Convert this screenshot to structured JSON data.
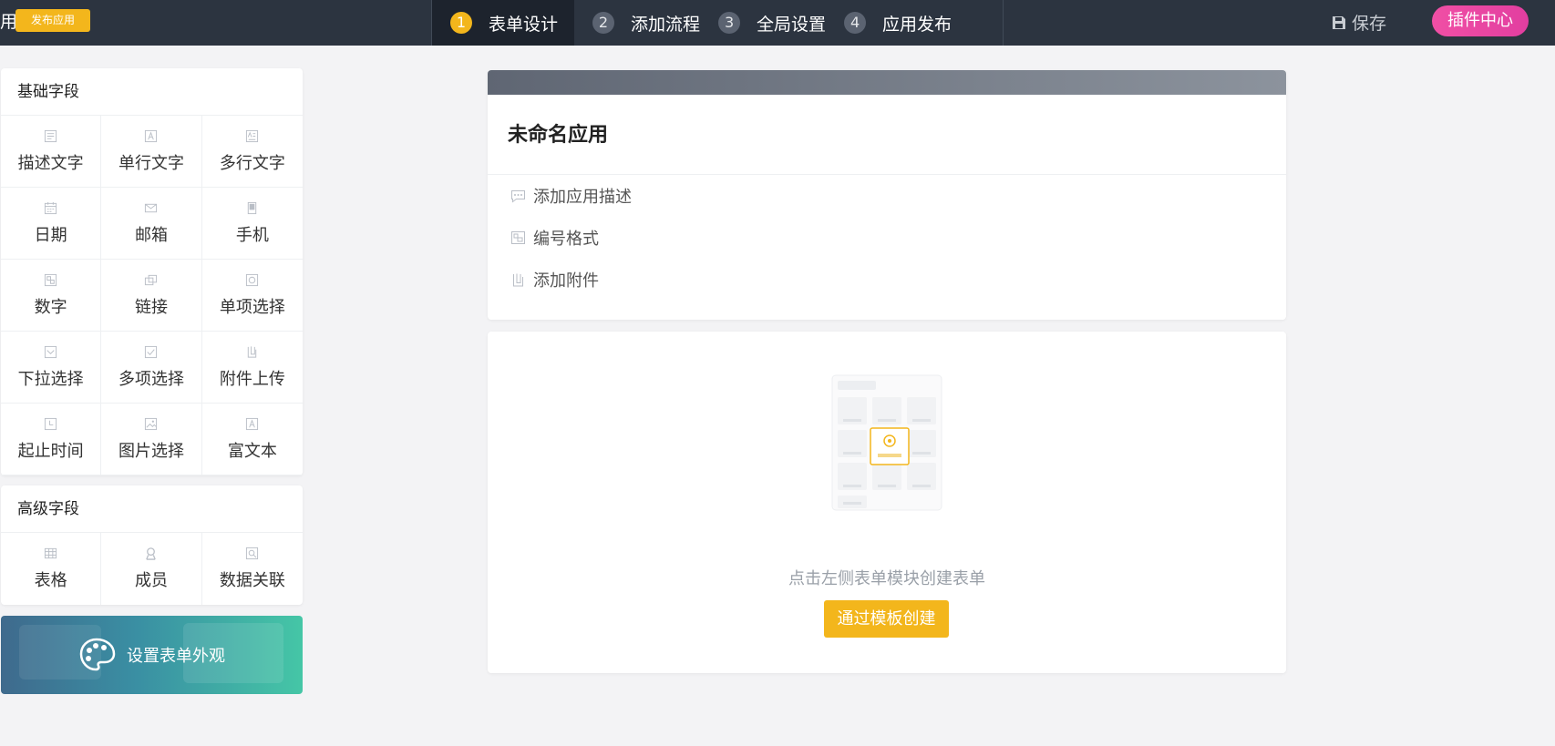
{
  "header": {
    "app_name_fragment": "用",
    "publish_badge": "发布应用",
    "steps": [
      {
        "num": "1",
        "label": "表单设计"
      },
      {
        "num": "2",
        "label": "添加流程"
      },
      {
        "num": "3",
        "label": "全局设置"
      },
      {
        "num": "4",
        "label": "应用发布"
      }
    ],
    "save_label": "保存",
    "plugin_label": "插件中心"
  },
  "sidebar": {
    "basic_title": "基础字段",
    "basic_fields": [
      {
        "label": "描述文字",
        "icon": "description-icon"
      },
      {
        "label": "单行文字",
        "icon": "single-line-text-icon"
      },
      {
        "label": "多行文字",
        "icon": "multi-line-text-icon"
      },
      {
        "label": "日期",
        "icon": "calendar-icon"
      },
      {
        "label": "邮箱",
        "icon": "mail-icon"
      },
      {
        "label": "手机",
        "icon": "phone-icon"
      },
      {
        "label": "数字",
        "icon": "number-icon"
      },
      {
        "label": "链接",
        "icon": "link-icon"
      },
      {
        "label": "单项选择",
        "icon": "radio-icon"
      },
      {
        "label": "下拉选择",
        "icon": "dropdown-icon"
      },
      {
        "label": "多项选择",
        "icon": "checkbox-icon"
      },
      {
        "label": "附件上传",
        "icon": "attachment-icon"
      },
      {
        "label": "起止时间",
        "icon": "clock-icon"
      },
      {
        "label": "图片选择",
        "icon": "image-icon"
      },
      {
        "label": "富文本",
        "icon": "rich-text-icon"
      }
    ],
    "advanced_title": "高级字段",
    "advanced_fields": [
      {
        "label": "表格",
        "icon": "table-icon"
      },
      {
        "label": "成员",
        "icon": "member-icon"
      },
      {
        "label": "数据关联",
        "icon": "data-link-icon"
      }
    ],
    "appearance_label": "设置表单外观"
  },
  "main": {
    "app_title": "未命名应用",
    "options": [
      {
        "label": "添加应用描述",
        "icon": "comment-icon"
      },
      {
        "label": "编号格式",
        "icon": "number-format-icon"
      },
      {
        "label": "添加附件",
        "icon": "attachment-icon"
      }
    ],
    "empty_hint": "点击左侧表单模块创建表单",
    "template_button": "通过模板创建"
  },
  "colors": {
    "accent": "#f3b61c",
    "topbar": "#2c3440",
    "plugin": "#e94aa3"
  }
}
